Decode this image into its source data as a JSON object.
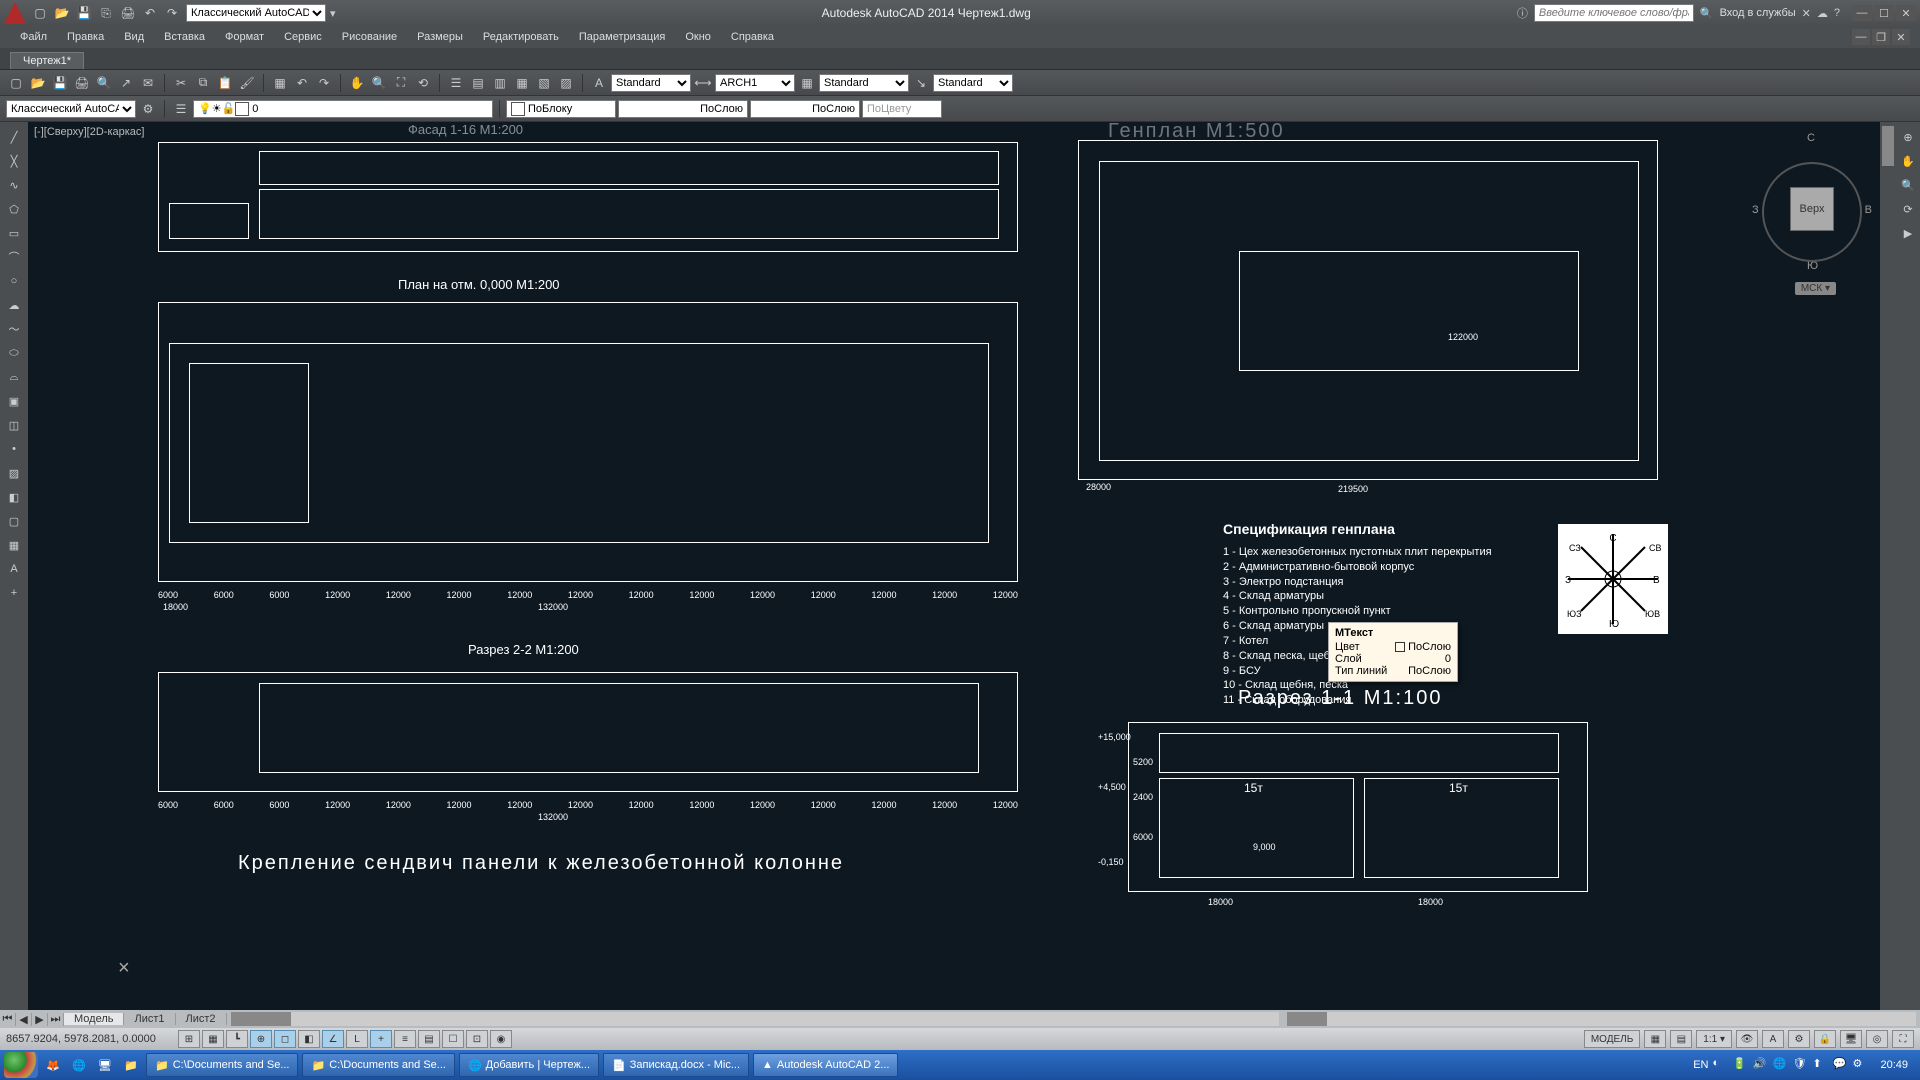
{
  "app": {
    "title": "Autodesk AutoCAD 2014   Чертеж1.dwg"
  },
  "workspace_select": "Классический AutoCAD",
  "search_placeholder": "Введите ключевое слово/фразу",
  "signin": "Вход в службы",
  "menubar": [
    "Файл",
    "Правка",
    "Вид",
    "Вставка",
    "Формат",
    "Сервис",
    "Рисование",
    "Размеры",
    "Редактировать",
    "Параметризация",
    "Окно",
    "Справка"
  ],
  "filetab": "Чертеж1*",
  "props": {
    "textstyle": "Standard",
    "dimstyle": "ARCH1",
    "tablestyle": "Standard",
    "mleader": "Standard",
    "color": "ПоБлоку",
    "lineweight": "ПоСлою",
    "linetype": "ПоСлою",
    "plotstyle": "ПоЦвету"
  },
  "layer": {
    "current": "0",
    "ws": "Классический AutoCAD"
  },
  "viewlabel": "[-][Сверху][2D-каркас]",
  "viewcube": {
    "face": "Верх",
    "n": "С",
    "s": "Ю",
    "e": "В",
    "w": "З",
    "wcs": "МСК ▾"
  },
  "headings": {
    "plan": "План на отм. 0,000 М1:200",
    "razrez22": "Разрез 2-2 М1:200",
    "sandwich": "Крепление сендвич панели к железобетонной колонне",
    "genplan": "Генплан М1:500",
    "spec_title": "Спецификация генплана",
    "razrez11": "Разрез 1-1 М1:100",
    "facade": "Фасад 1-16 М1:200"
  },
  "spec_items": [
    "1 - Цех железобетонных пустотных плит перекрытия",
    "2 - Административно-бытовой корпус",
    "3 - Электро подстанция",
    "4 - Склад арматуры",
    "5 - Контрольно пропускной пункт",
    "6 - Склад арматуры",
    "7 - Котел",
    "8 - Склад песка, щебня, цемента",
    "9 - БСУ",
    "10 - Склад щебня, песка",
    "11 - Склад оборудования"
  ],
  "dims": {
    "row": [
      "6000",
      "6000",
      "6000",
      "12000",
      "12000",
      "12000",
      "12000",
      "12000",
      "12000",
      "12000",
      "12000",
      "12000",
      "12000",
      "12000",
      "12000"
    ],
    "total": "132000",
    "side18000": "18000",
    "gp_w": "219500",
    "gp_h": "28000",
    "gp_mid": "122000",
    "r11_15t": "15т",
    "r11_6000": "6000",
    "r11_5200": "5200",
    "r11_2400": "2400",
    "r11_m015": "-0,150",
    "r11_m45": "+4,500",
    "r11_m15": "+15,000",
    "r11_9000": "9,000",
    "r11_18000": "18000"
  },
  "compass_labels": [
    "С",
    "СВ",
    "В",
    "ЮВ",
    "Ю",
    "ЮЗ",
    "З",
    "СЗ"
  ],
  "tooltip": {
    "title": "МТекст",
    "color_label": "Цвет",
    "color_value": "ПоСлою",
    "layer_label": "Слой",
    "layer_value": "0",
    "lt_label": "Тип линий",
    "lt_value": "ПоСлою"
  },
  "modeltabs": {
    "model": "Модель",
    "sheet1": "Лист1",
    "sheet2": "Лист2"
  },
  "status": {
    "coords": "8657.9204, 5978.2081, 0.0000",
    "model": "МОДЕЛЬ",
    "scale": "1:1 ▾"
  },
  "taskbar": {
    "items": [
      "C:\\Documents and Se...",
      "C:\\Documents and Se...",
      "Добавить | Чертеж...",
      "Запискад.docx - Mic...",
      "Autodesk AutoCAD 2..."
    ],
    "lang": "EN",
    "clock": "20:49"
  }
}
